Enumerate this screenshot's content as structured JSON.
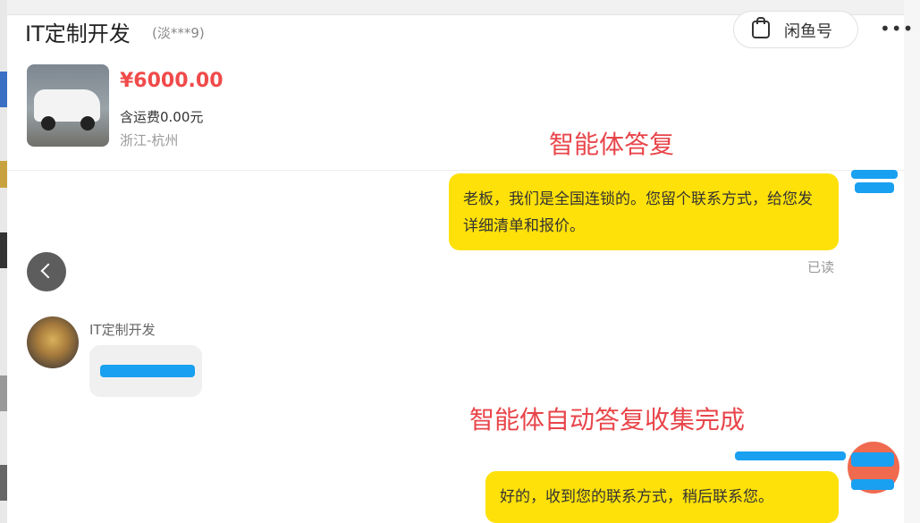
{
  "header": {
    "title": "IT定制开发",
    "subtitle": "(淡***9)",
    "xianyu_label": "闲鱼号",
    "more_label": "•••"
  },
  "product": {
    "price": "¥6000.00",
    "shipping": "含运费0.00元",
    "location": "浙江-杭州"
  },
  "annotations": {
    "first": "智能体答复",
    "second": "智能体自动答复收集完成"
  },
  "messages": {
    "reply_1": "老板，我们是全国连锁的。您留个联系方式，给您发详细清单和报价。",
    "read_status": "已读",
    "other_name": "IT定制开发",
    "reply_2": "好的，收到您的联系方式，稍后联系您。"
  },
  "colors": {
    "my_bubble": "#ffe10a",
    "price": "#f04a4a",
    "annotation": "#e8454a",
    "redaction": "#1aa0f0"
  }
}
